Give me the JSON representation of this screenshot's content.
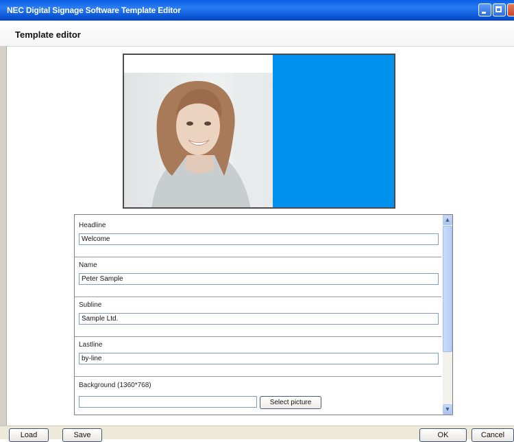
{
  "window": {
    "title": "NEC Digital Signage Software Template Editor",
    "controls": {
      "minimize_icon": "minimize-icon",
      "maximize_icon": "maximize-icon",
      "close_icon": "close-icon"
    }
  },
  "header": {
    "title": "Template editor"
  },
  "preview": {
    "photo": "portrait of smiling woman",
    "accent_color": "#0091ee"
  },
  "form": {
    "fields": [
      {
        "label": "Headline",
        "value": "Welcome"
      },
      {
        "label": "Name",
        "value": "Peter Sample"
      },
      {
        "label": "Subline",
        "value": "Sample Ltd."
      },
      {
        "label": "Lastline",
        "value": "by-line"
      }
    ],
    "background": {
      "label": "Background (1360*768)",
      "value": "",
      "button_label": "Select picture"
    }
  },
  "footer": {
    "load_label": "Load",
    "save_label": "Save",
    "ok_label": "OK",
    "cancel_label": "Cancel"
  },
  "colors": {
    "titlebar": "#0a5fe6",
    "accent": "#0091ee"
  }
}
